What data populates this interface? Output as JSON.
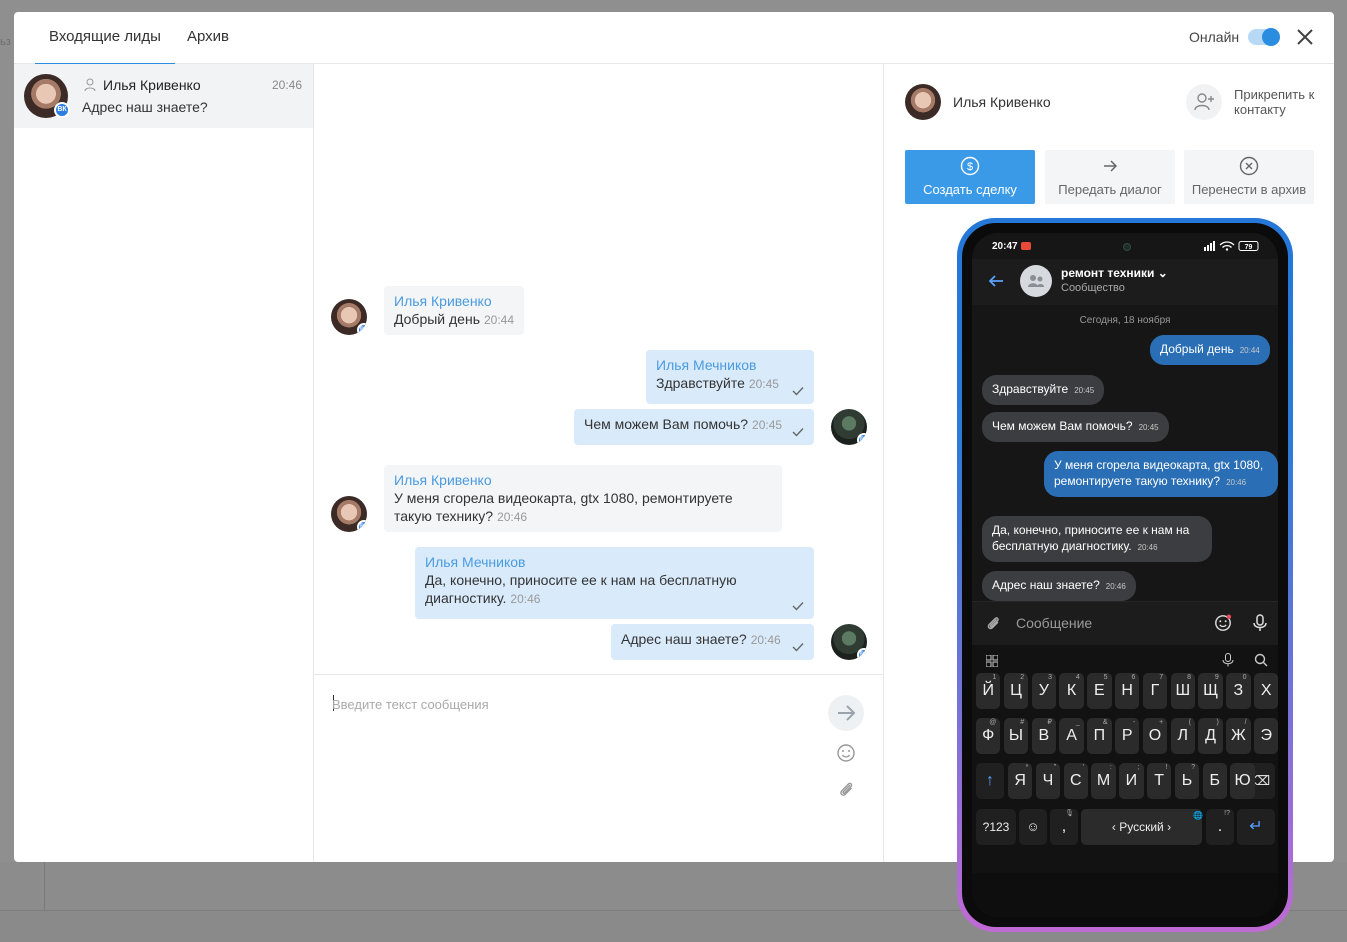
{
  "backdrop": {
    "left_text": "ьз"
  },
  "header": {
    "tabs": [
      {
        "label": "Входящие лиды",
        "active": true
      },
      {
        "label": "Архив",
        "active": false
      }
    ],
    "online_label": "Онлайн",
    "online_enabled": true
  },
  "leads": [
    {
      "name": "Илья Кривенко",
      "time": "20:46",
      "preview": "Адрес наш знаете?",
      "source": "ВК"
    }
  ],
  "chat": {
    "messages": [
      {
        "author": "Илья Кривенко",
        "text": "Добрый день",
        "time": "20:44"
      },
      {
        "author": "Илья Мечников",
        "text": "Здравствуйте",
        "time": "20:45"
      },
      {
        "text": "Чем можем Вам помочь?",
        "time": "20:45"
      },
      {
        "author": "Илья Кривенко",
        "text": "У меня сгорела видеокарта, gtx 1080, ремонтируете такую технику?",
        "time": "20:46"
      },
      {
        "author": "Илья Мечников",
        "text": "Да, конечно, приносите ее к нам на бесплатную диагностику.",
        "time": "20:46"
      },
      {
        "text": "Адрес наш знаете?",
        "time": "20:46"
      }
    ],
    "composer_placeholder": "Введите текст сообщения"
  },
  "contact_panel": {
    "name": "Илья Кривенко",
    "attach_label": "Прикрепить к контакту",
    "actions": {
      "create_deal": "Создать сделку",
      "transfer": "Передать диалог",
      "archive": "Перенести в архив"
    }
  },
  "phone": {
    "status_time": "20:47",
    "battery": "79",
    "community_name": "ремонт техники",
    "community_sub": "Сообщество",
    "date_separator": "Сегодня, 18 ноября",
    "messages": [
      {
        "text": "Добрый день",
        "time": "20:44"
      },
      {
        "text": "Здравствуйте",
        "time": "20:45"
      },
      {
        "text": "Чем можем Вам помочь?",
        "time": "20:45"
      },
      {
        "text": "У меня сгорела видеокарта, gtx 1080, ремонтируете такую технику?",
        "time": "20:46"
      },
      {
        "text": "Да, конечно, приносите ее к нам на бесплатную диагностику.",
        "time": "20:46"
      },
      {
        "text": "Адрес наш знаете?",
        "time": "20:46"
      }
    ],
    "input_placeholder": "Сообщение",
    "keyboard": {
      "row1": [
        "Й",
        "Ц",
        "У",
        "К",
        "Е",
        "Н",
        "Г",
        "Ш",
        "Щ",
        "З",
        "Х"
      ],
      "row1_sub": [
        "1",
        "2",
        "3",
        "4",
        "5",
        "6",
        "7",
        "8",
        "9",
        "0",
        ""
      ],
      "row2": [
        "Ф",
        "Ы",
        "В",
        "А",
        "П",
        "Р",
        "О",
        "Л",
        "Д",
        "Ж",
        "Э"
      ],
      "row2_sub": [
        "@",
        "#",
        "₽",
        "_",
        "&",
        "-",
        "+",
        "(",
        ")",
        "/",
        ""
      ],
      "row3": [
        "Я",
        "Ч",
        "С",
        "М",
        "И",
        "Т",
        "Ь",
        "Б",
        "Ю"
      ],
      "row3_sub": [
        "*",
        "\"",
        "'",
        ":",
        ";",
        "!",
        "?",
        "",
        ""
      ],
      "sym_key": "?123",
      "comma": ",",
      "space_label": "Русский",
      "period": ".",
      "period_sub": "!?"
    }
  },
  "colors": {
    "accent": "#2b8de0",
    "author": "#4a9be0",
    "out_bubble": "#d9ebfb",
    "in_bubble": "#f3f5f7",
    "primary_button": "#3a9ae8",
    "phone_out_bubble": "#2a6fb5",
    "phone_in_bubble": "#3b3d40"
  }
}
